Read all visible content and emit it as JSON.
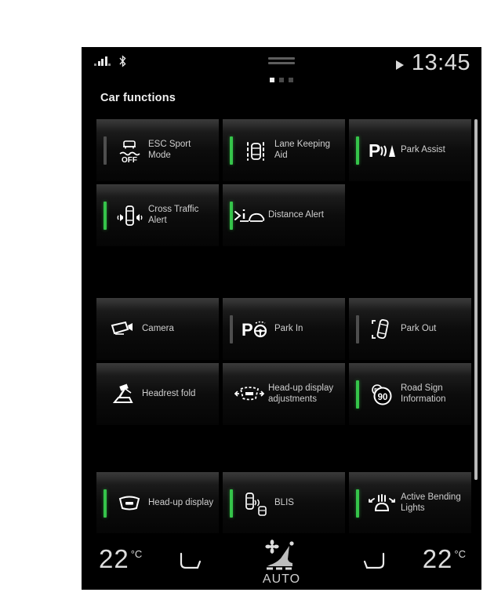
{
  "statusbar": {
    "signal_icon": "signal-bars-icon",
    "bluetooth_icon": "bluetooth-icon",
    "drag_handle_icon": "drag-handle-icon",
    "media_play_icon": "play-triangle-icon",
    "time": "13:45",
    "page_dots": {
      "count": 3,
      "active_index": 0
    }
  },
  "header": {
    "title": "Car functions"
  },
  "grid": {
    "groups": [
      {
        "rows": [
          [
            {
              "label": "ESC Sport Mode",
              "icon": "esc-off-icon",
              "indicator": "off"
            },
            {
              "label": "Lane Keeping Aid",
              "icon": "lane-keeping-aid-icon",
              "indicator": "on"
            },
            {
              "label": "Park Assist",
              "icon": "park-assist-icon",
              "indicator": "on"
            }
          ],
          [
            {
              "label": "Cross Traffic Alert",
              "icon": "cross-traffic-alert-icon",
              "indicator": "on"
            },
            {
              "label": "Distance Alert",
              "icon": "distance-alert-icon",
              "indicator": "on"
            },
            {
              "label": "",
              "icon": "",
              "indicator": "empty"
            }
          ]
        ]
      },
      {
        "rows": [
          [
            {
              "label": "Camera",
              "icon": "camera-icon",
              "indicator": "none"
            },
            {
              "label": "Park In",
              "icon": "park-in-icon",
              "indicator": "off"
            },
            {
              "label": "Park Out",
              "icon": "park-out-icon",
              "indicator": "off"
            }
          ],
          [
            {
              "label": "Headrest fold",
              "icon": "headrest-fold-icon",
              "indicator": "none"
            },
            {
              "label": "Head-up display adjustments",
              "icon": "hud-adjust-icon",
              "indicator": "none"
            },
            {
              "label": "Road Sign Information",
              "icon": "road-sign-90-icon",
              "indicator": "on"
            }
          ]
        ]
      },
      {
        "rows": [
          [
            {
              "label": "Head-up display",
              "icon": "head-up-display-icon",
              "indicator": "on"
            },
            {
              "label": "BLIS",
              "icon": "blis-icon",
              "indicator": "on"
            },
            {
              "label": "Active Bending Lights",
              "icon": "active-bending-lights-icon",
              "indicator": "on"
            }
          ]
        ]
      }
    ]
  },
  "climate": {
    "left_temp": "22",
    "left_unit": "°C",
    "right_temp": "22",
    "right_unit": "°C",
    "left_seat_icon": "driver-seat-heat-icon",
    "right_seat_icon": "passenger-seat-heat-icon",
    "center_icon": "auto-climate-seat-icon",
    "auto_label": "AUTO"
  },
  "colors": {
    "indicator_on": "#35c44a",
    "indicator_off": "#4e4e4e",
    "text": "#cfcfcf",
    "background": "#000000"
  }
}
